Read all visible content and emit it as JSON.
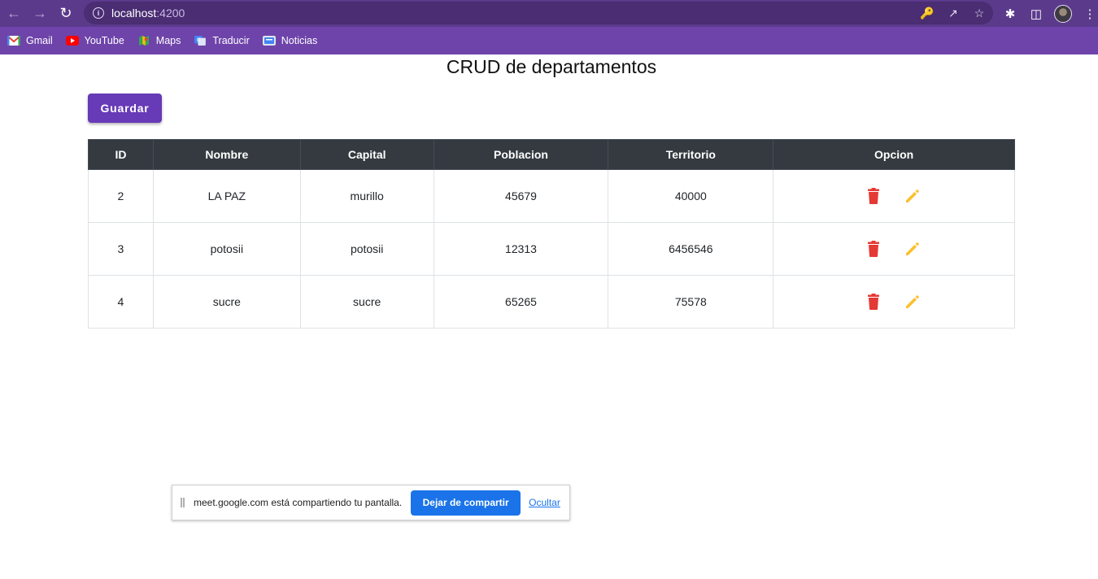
{
  "browser": {
    "url_host": "localhost",
    "url_port": ":4200",
    "bookmarks": [
      {
        "label": "Gmail",
        "icon": "gmail-icon",
        "color": "#ea4335"
      },
      {
        "label": "YouTube",
        "icon": "youtube-icon",
        "color": "#ff0000"
      },
      {
        "label": "Maps",
        "icon": "maps-icon",
        "color": "#34a853"
      },
      {
        "label": "Traducir",
        "icon": "translate-icon",
        "color": "#4285f4"
      },
      {
        "label": "Noticias",
        "icon": "news-icon",
        "color": "#4285f4"
      }
    ]
  },
  "page": {
    "title": "CRUD de departamentos",
    "save_label": "Guardar"
  },
  "table": {
    "headers": [
      "ID",
      "Nombre",
      "Capital",
      "Poblacion",
      "Territorio",
      "Opcion"
    ],
    "rows": [
      {
        "id": "2",
        "nombre": "LA PAZ",
        "capital": "murillo",
        "poblacion": "45679",
        "territorio": "40000"
      },
      {
        "id": "3",
        "nombre": "potosii",
        "capital": "potosii",
        "poblacion": "12313",
        "territorio": "6456546"
      },
      {
        "id": "4",
        "nombre": "sucre",
        "capital": "sucre",
        "poblacion": "65265",
        "territorio": "75578"
      }
    ],
    "delete_icon_color": "#e53935",
    "edit_icon_color": "#fbc02d"
  },
  "share_bar": {
    "message": "meet.google.com está compartiendo tu pantalla.",
    "stop_label": "Dejar de compartir",
    "hide_label": "Ocultar"
  },
  "colors": {
    "primary": "#673ab7",
    "table_header": "#343a40",
    "chrome": "#5b3a8c"
  }
}
